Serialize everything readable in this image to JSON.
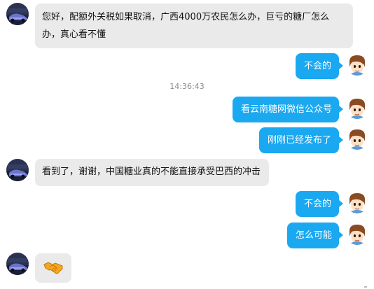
{
  "conversation": {
    "timestamp": "14:36:43",
    "messages": [
      {
        "sender": "other",
        "text": "您好，配额外关税如果取消，广西4000万农民怎么办，巨亏的糖厂怎么办，真心看不懂"
      },
      {
        "sender": "self",
        "text": "不会的"
      },
      {
        "sender": "self",
        "text": "看云南糖网微信公众号"
      },
      {
        "sender": "self",
        "text": "刚刚已经发布了"
      },
      {
        "sender": "other",
        "text": "看到了，谢谢，中国糖业真的不能直接承受巴西的冲击"
      },
      {
        "sender": "self",
        "text": "不会的"
      },
      {
        "sender": "self",
        "text": "怎么可能"
      },
      {
        "sender": "other",
        "emoji": "handshake-emoji"
      }
    ]
  },
  "colors": {
    "outgoing_bubble": "#1aa8f1",
    "incoming_bubble": "#eaeaea",
    "timestamp_text": "#8a8a8a"
  }
}
